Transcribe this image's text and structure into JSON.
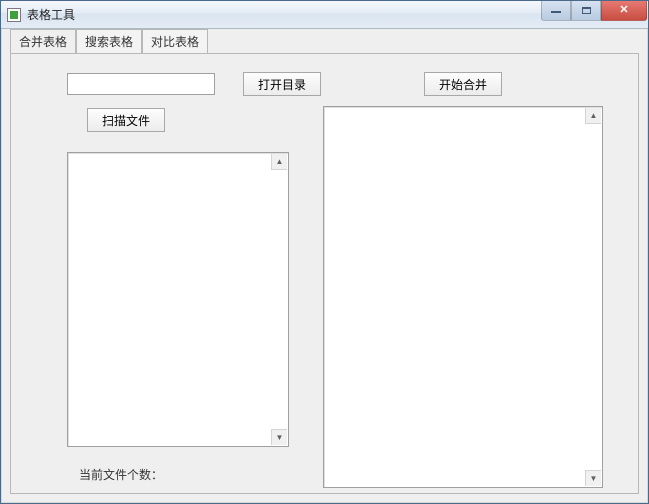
{
  "window": {
    "title": "表格工具"
  },
  "tabs": [
    {
      "label": "合并表格"
    },
    {
      "label": "搜索表格"
    },
    {
      "label": "对比表格"
    }
  ],
  "main": {
    "path_value": "",
    "open_dir_label": "打开目录",
    "scan_label": "扫描文件",
    "start_merge_label": "开始合并"
  },
  "status": {
    "file_count_label": "当前文件个数：",
    "file_count_value": ""
  }
}
